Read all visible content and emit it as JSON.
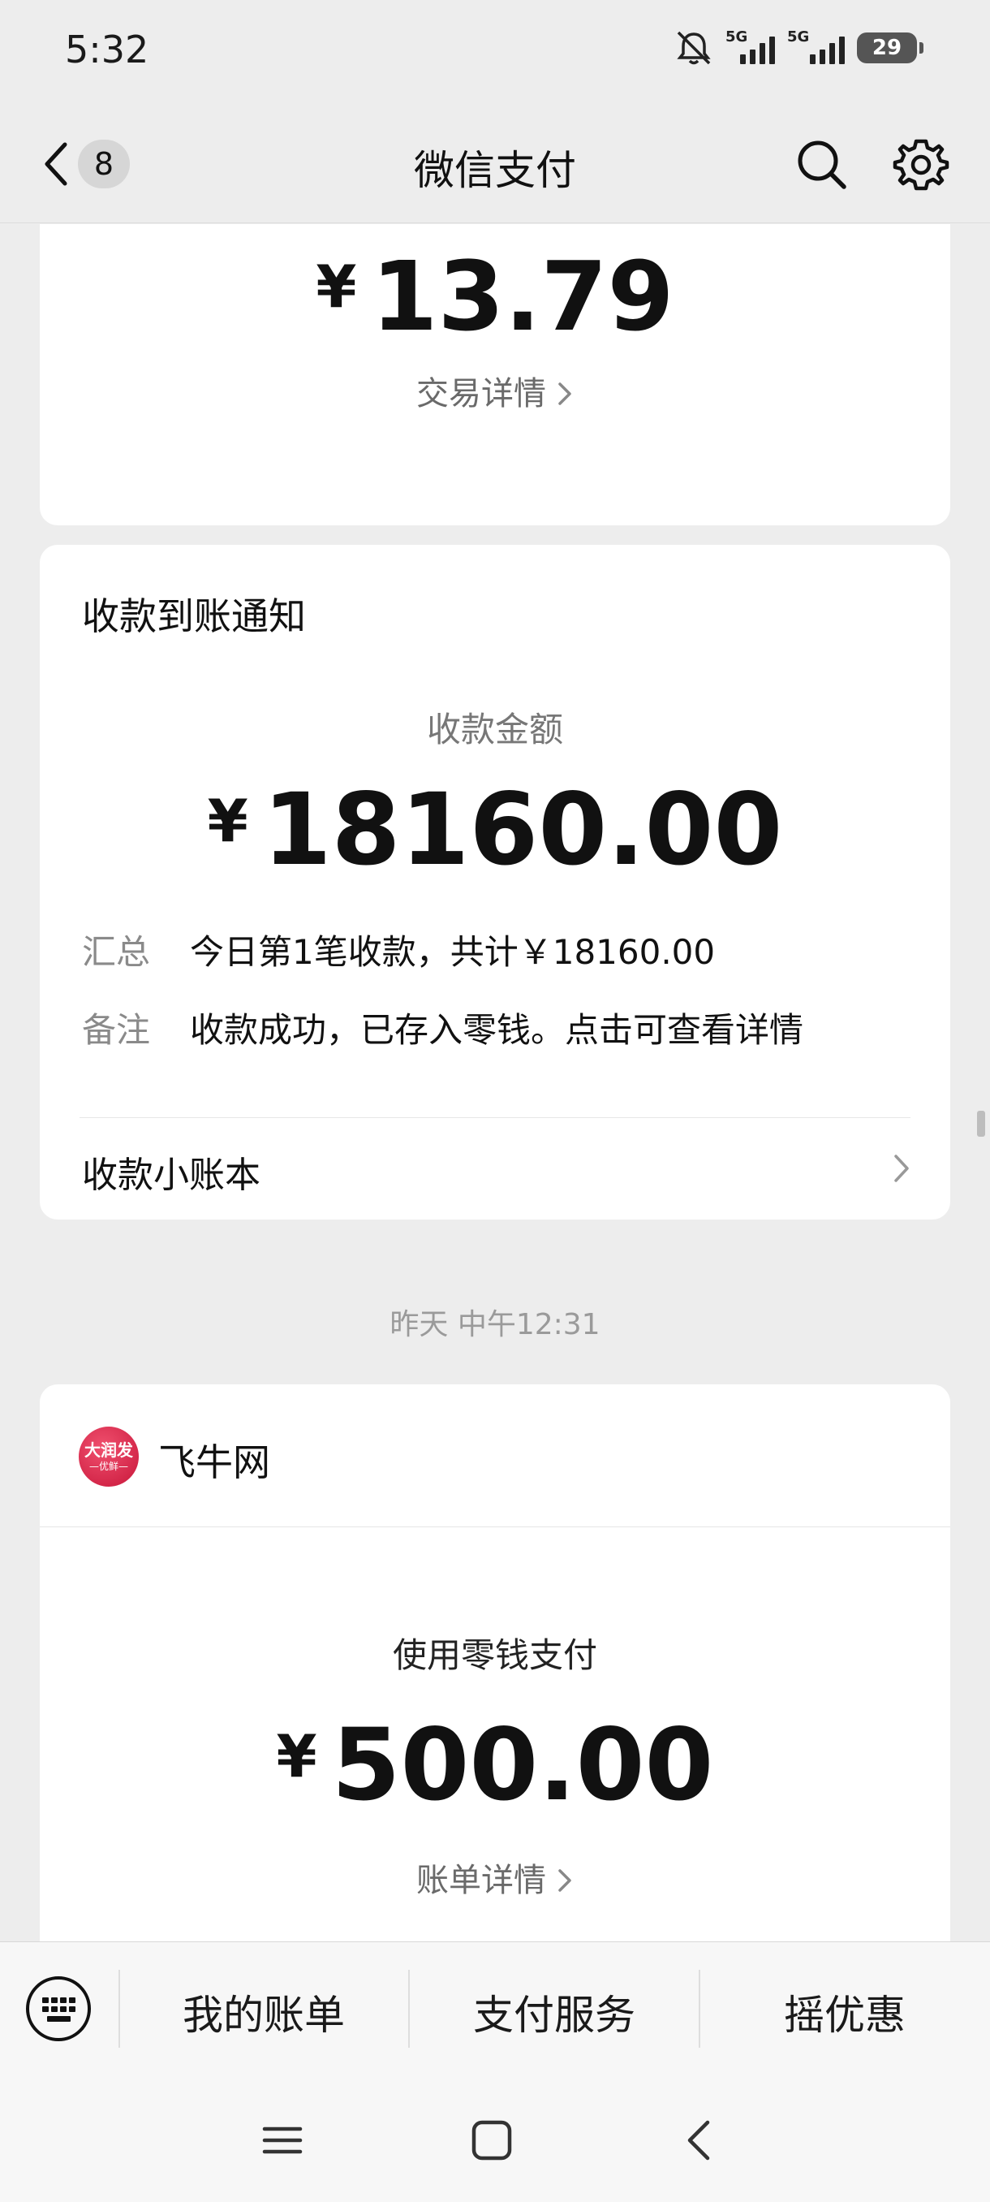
{
  "status_bar": {
    "time": "5:32",
    "signal1_label": "5G",
    "signal2_label": "5G",
    "battery": "29"
  },
  "nav": {
    "badge_count": "8",
    "title": "微信支付"
  },
  "card_top": {
    "currency": "¥",
    "amount": "13.79",
    "link": "交易详情"
  },
  "card_receipt": {
    "title": "收款到账通知",
    "amount_label": "收款金额",
    "currency": "¥",
    "amount": "18160.00",
    "summary_key": "汇总",
    "summary_value": "今日第1笔收款，共计￥18160.00",
    "note_key": "备注",
    "note_value": "收款成功，已存入零钱。点击可查看详情",
    "ledger_label": "收款小账本"
  },
  "timestamp": "昨天 中午12:31",
  "card_payment": {
    "merchant_logo_line1": "大润发",
    "merchant_logo_line2": "—优鲜—",
    "merchant_name": "飞牛网",
    "pay_method": "使用零钱支付",
    "currency": "¥",
    "amount": "500.00",
    "link": "账单详情"
  },
  "bottom_menu": {
    "items": [
      "我的账单",
      "支付服务",
      "摇优惠"
    ]
  },
  "icons": {
    "back": "chevron-left-icon",
    "search": "search-icon",
    "settings": "gear-icon",
    "keyboard": "keyboard-icon"
  }
}
